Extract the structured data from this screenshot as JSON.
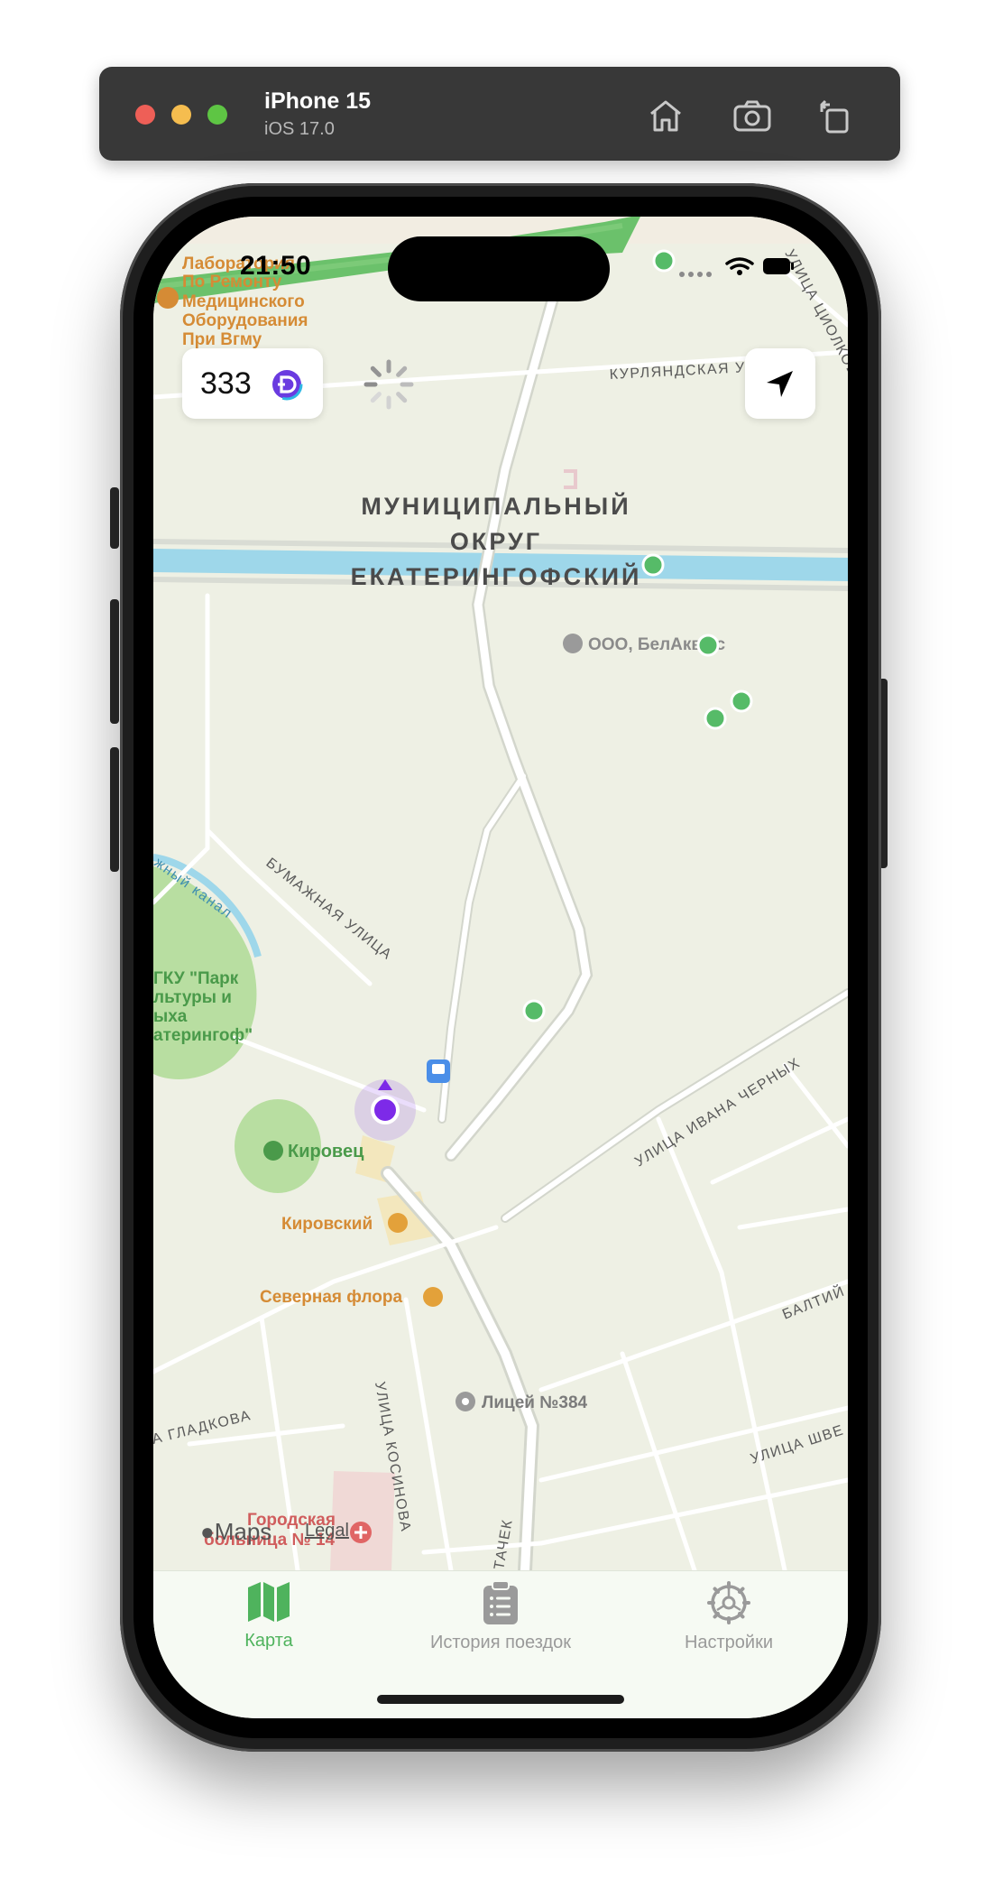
{
  "simulator": {
    "device_name": "iPhone 15",
    "os_version": "iOS 17.0",
    "home_icon": "home-icon",
    "screenshot_icon": "camera-icon",
    "rotate_icon": "rotate-icon"
  },
  "status_bar": {
    "time": "21:50"
  },
  "map": {
    "district_label_line1": "МУНИЦИПАЛЬНЫЙ",
    "district_label_line2": "ОКРУГ",
    "district_label_line3": "ЕКАТЕРИНГОФСКИЙ",
    "streets": {
      "kurlyandskaya": "КУРЛЯНДСКАЯ УЛ",
      "tsiolkovskogo": "УЛИЦА ЦИОЛКОВ",
      "bumazhnaya": "БУМАЖНАЯ УЛИЦА",
      "ivana_chernykh": "УЛИЦА ИВАНА ЧЕРНЫХ",
      "baltiyskaya": "БАЛТИЙ",
      "gladkova": "А ГЛАДКОВА",
      "kosinova": "УЛИЦА КОСИНОВА",
      "shvetsova": "УЛИЦА ШВЕ",
      "stachek": "ТАЧЕК",
      "canal": "жный канал"
    },
    "pois": {
      "lab_line1": "Лаборатория",
      "lab_line2": "По Ремонту",
      "lab_line3": "Медицинского",
      "lab_line4": "Оборудования",
      "lab_line5": "При Вгму",
      "belakvus": "ООО, БелАкв ус",
      "park_line1": "ГКУ \"Парк",
      "park_line2": "льтуры и",
      "park_line3": "ыха",
      "park_line4": "атерингоф\"",
      "kirovets": "Кировец",
      "kirovsky": "Кировский",
      "severnaya_flora": "Северная флора",
      "licey": "Лицей №384",
      "hospital_line1": "Городская",
      "hospital_line2": "больница № 14"
    },
    "attribution": {
      "logo": "Maps",
      "legal": "Legal"
    }
  },
  "overlay": {
    "coin_balance": "333",
    "coin_icon": "coin-icon",
    "locate_icon": "location-arrow-icon"
  },
  "tabbar": {
    "tabs": [
      {
        "label": "Карта",
        "icon": "map-icon",
        "active": true
      },
      {
        "label": "История поездок",
        "icon": "clipboard-list-icon",
        "active": false
      },
      {
        "label": "Настройки",
        "icon": "gear-icon",
        "active": false
      }
    ]
  },
  "colors": {
    "accent_green": "#4fb35d",
    "scooter_marker": "#56bb68",
    "user_location": "#7d2ae8",
    "water": "#9ed7ea",
    "park": "#b8dea1"
  }
}
